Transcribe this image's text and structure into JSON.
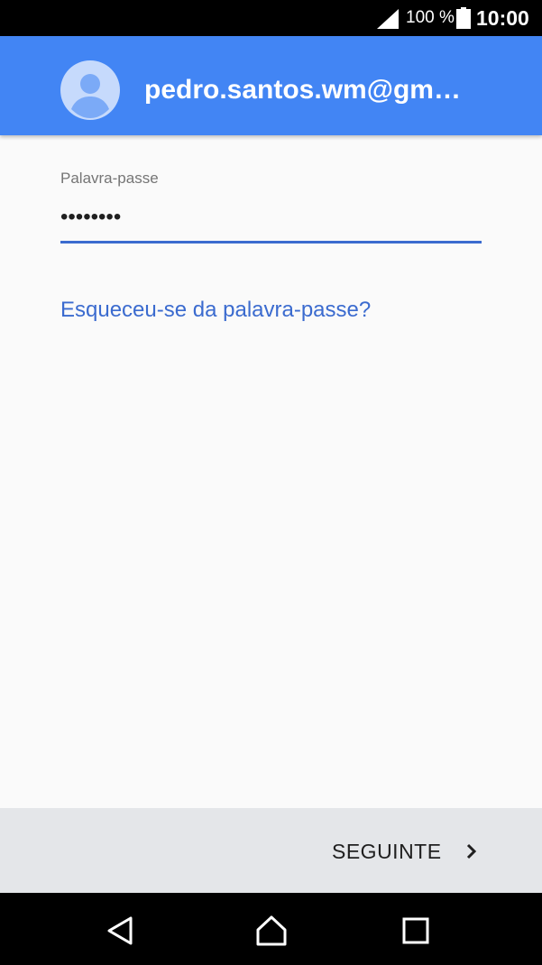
{
  "status_bar": {
    "battery_percent": "100 %",
    "time": "10:00",
    "icons": [
      "signal-icon",
      "battery-icon"
    ]
  },
  "header": {
    "account_email": "pedro.santos.wm@gm…",
    "background_color": "#4285f4",
    "avatar_icon": "avatar-icon"
  },
  "password_field": {
    "label": "Palavra-passe",
    "value": "••••••••",
    "accent_color": "#3b6bcf"
  },
  "forgot_link": {
    "label": "Esqueceu-se da palavra-passe?"
  },
  "footer": {
    "next_label": "SEGUINTE",
    "next_icon": "chevron-right-icon"
  },
  "nav_bar": {
    "icons": [
      "back-icon",
      "home-icon",
      "recents-icon"
    ]
  }
}
